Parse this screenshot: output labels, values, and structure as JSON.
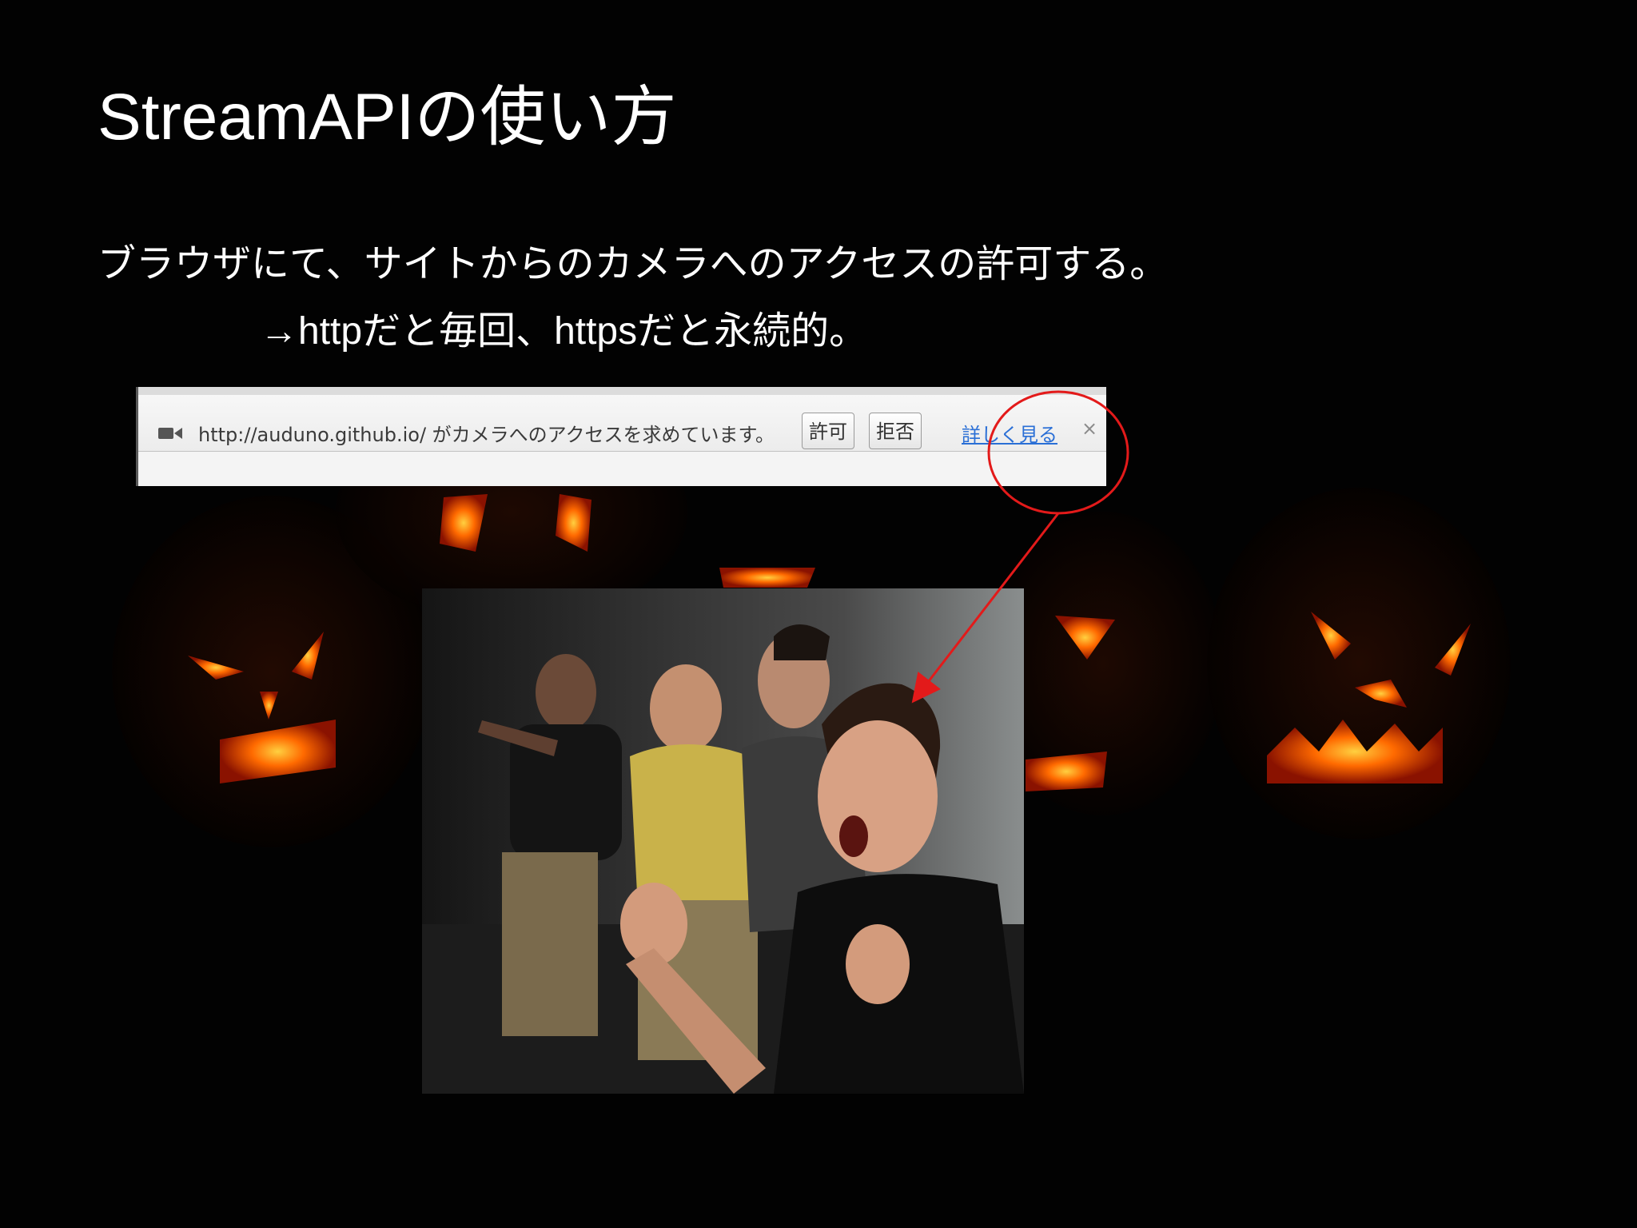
{
  "slide": {
    "title": "StreamAPIの使い方",
    "line1": "ブラウザにて、サイトからのカメラへのアクセスの許可する。",
    "line2": "→httpだと毎回、httpsだと永続的。"
  },
  "infobar": {
    "message": "http://auduno.github.io/ がカメラへのアクセスを求めています。",
    "allow_label": "許可",
    "deny_label": "拒否",
    "learn_more_label": "詳しく見る",
    "close_label": "×",
    "icon": "video-camera-icon"
  },
  "colors": {
    "background": "#000000",
    "text": "#ffffff",
    "annotation": "#e31a1a",
    "pumpkin_glow": "#ff7a10",
    "link": "#2a6fd6"
  }
}
